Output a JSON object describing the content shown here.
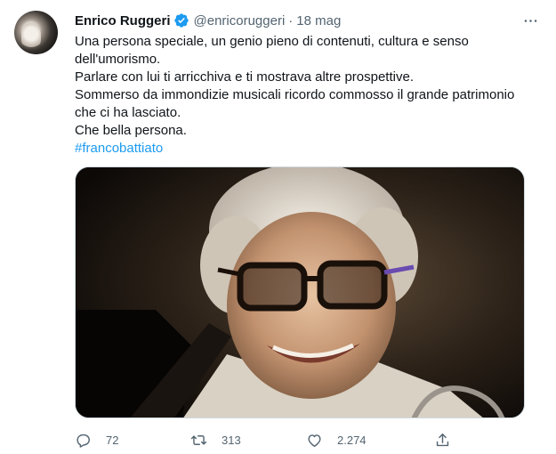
{
  "author": {
    "name": "Enrico Ruggeri",
    "handle": "@enricoruggeri",
    "separator": "·",
    "date": "18 mag"
  },
  "tweet": {
    "lines": [
      "Una persona speciale, un genio pieno di contenuti, cultura e senso",
      "dell'umorismo.",
      "Parlare con lui ti arricchiva e ti mostrava altre prospettive.",
      "Sommerso da immondizie musicali ricordo commosso il grande patrimonio",
      "che ci ha lasciato.",
      "Che bella persona."
    ],
    "hashtag": "#francobattiato"
  },
  "actions": {
    "replies": "72",
    "retweets": "313",
    "likes": "2.274"
  },
  "icons": {
    "verified": "verified-badge-icon",
    "more": "more-icon",
    "reply": "reply-icon",
    "retweet": "retweet-icon",
    "like": "heart-icon",
    "share": "share-icon"
  },
  "colors": {
    "text": "#0f1419",
    "secondary": "#536471",
    "accent": "#1d9bf0"
  }
}
